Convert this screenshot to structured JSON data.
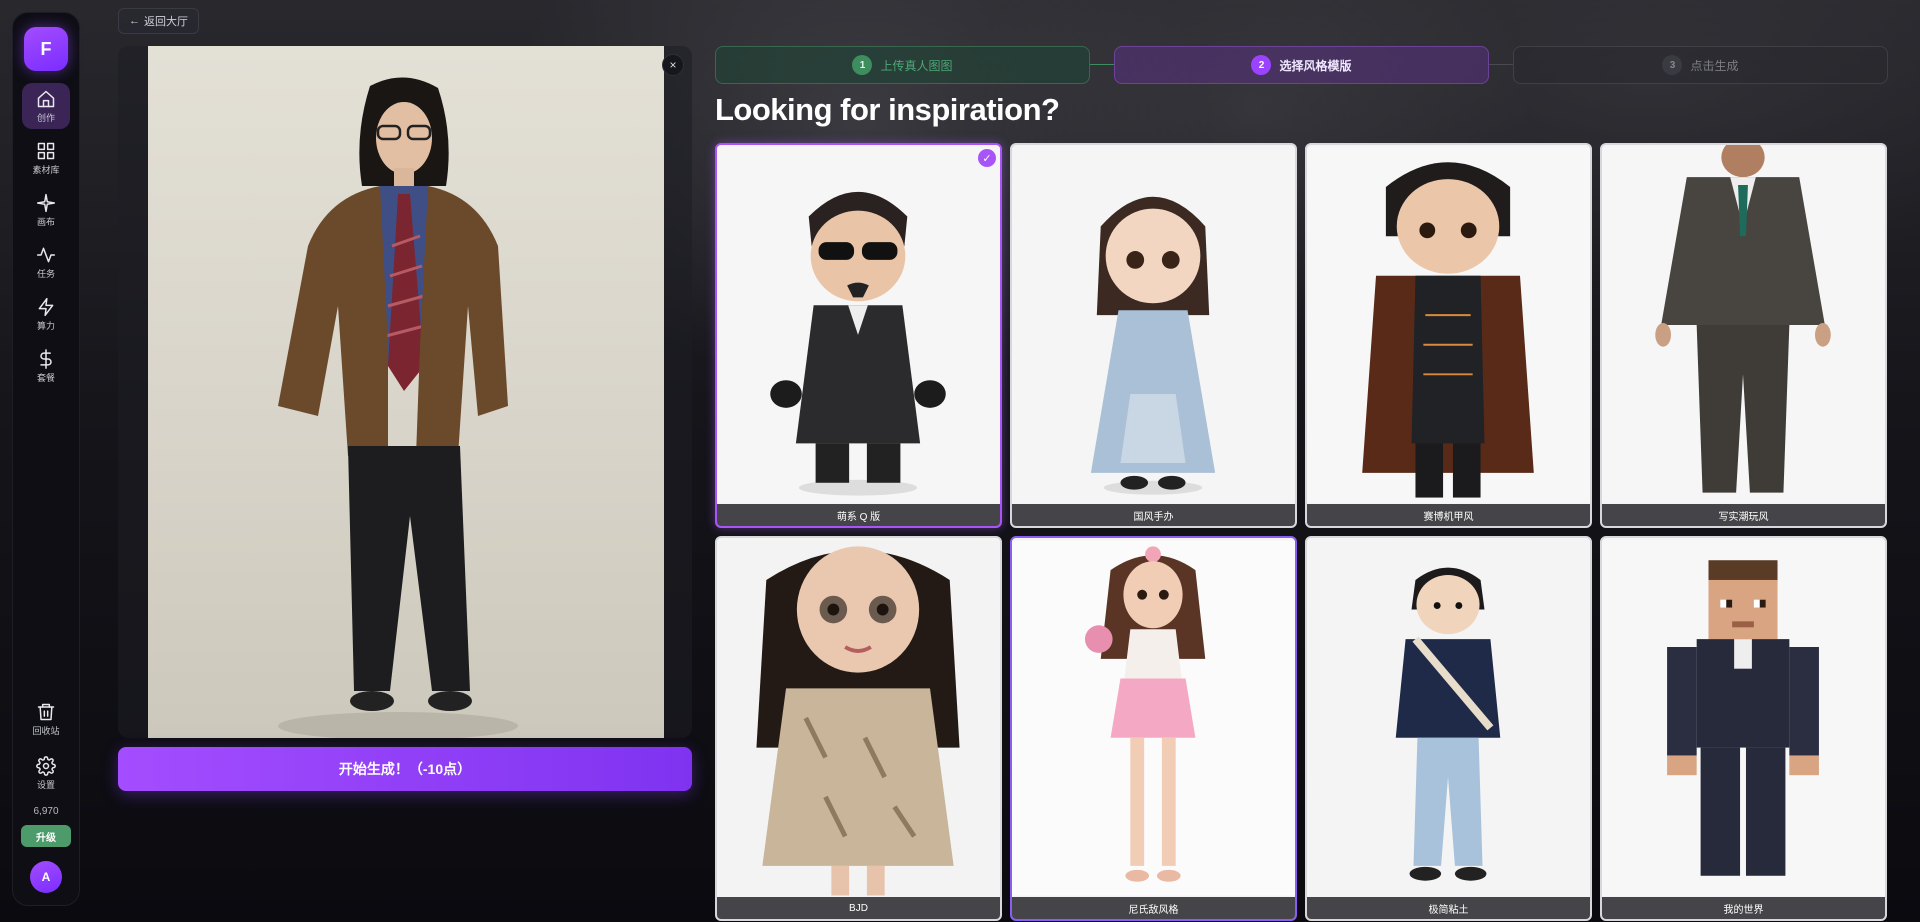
{
  "sidebar": {
    "logo": "F",
    "items": [
      {
        "label": "创作",
        "icon": "home-icon",
        "active": true
      },
      {
        "label": "素材库",
        "icon": "grid-icon",
        "active": false
      },
      {
        "label": "画布",
        "icon": "sparkle-icon",
        "active": false
      },
      {
        "label": "任务",
        "icon": "activity-icon",
        "active": false
      },
      {
        "label": "算力",
        "icon": "lightning-icon",
        "active": false
      },
      {
        "label": "套餐",
        "icon": "dollar-icon",
        "active": false
      }
    ],
    "trash_label": "回收站",
    "settings_label": "设置",
    "credits": "6,970",
    "upgrade_label": "升级",
    "avatar_initial": "A"
  },
  "back_button": "返回大厅",
  "close_label": "×",
  "generate_button": "开始生成！（-10点）",
  "steps": [
    {
      "number": "1",
      "label": "上传真人图图",
      "state": "done"
    },
    {
      "number": "2",
      "label": "选择风格模版",
      "state": "active"
    },
    {
      "number": "3",
      "label": "点击生成",
      "state": "pending"
    }
  ],
  "heading": "Looking for inspiration?",
  "styles": [
    {
      "label": "萌系 Q 版",
      "selected": true
    },
    {
      "label": "国风手办",
      "selected": false
    },
    {
      "label": "赛博机甲风",
      "selected": false
    },
    {
      "label": "写实潮玩风",
      "selected": false
    },
    {
      "label": "BJD",
      "selected": false
    },
    {
      "label": "尼氏敌风格",
      "selected": false
    },
    {
      "label": "极简粘土",
      "selected": false
    },
    {
      "label": "我的世界",
      "selected": false
    }
  ],
  "colors": {
    "accent": "#a855f7",
    "step_done": "#3e8d5f",
    "upgrade": "#4d9b6a"
  }
}
